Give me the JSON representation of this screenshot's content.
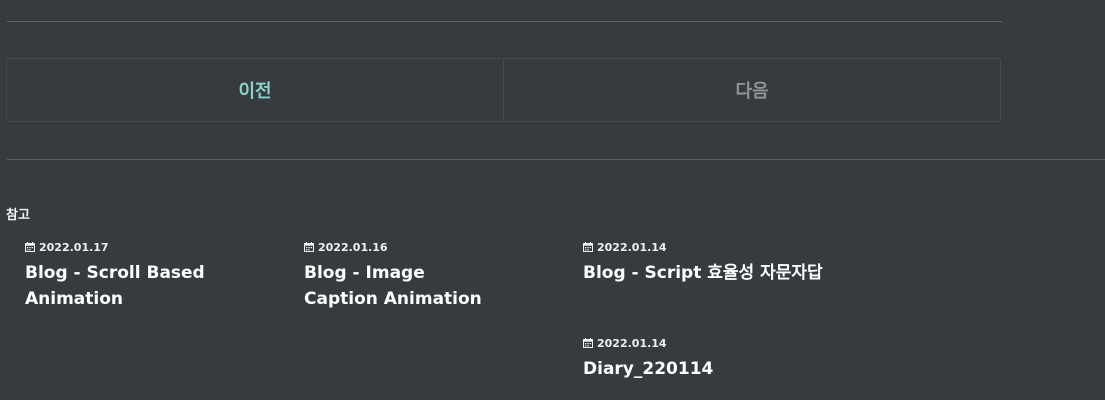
{
  "pager": {
    "prev_label": "이전",
    "next_label": "다음"
  },
  "related": {
    "title": "참고",
    "posts": [
      {
        "date": "2022.01.17",
        "title": "Blog - Scroll Based Animation"
      },
      {
        "date": "2022.01.16",
        "title": "Blog - Image Caption Animation"
      },
      {
        "date": "2022.01.14",
        "title": "Blog - Script 효율성 자문자답"
      },
      {
        "date": "2022.01.14",
        "title": "Diary_220114"
      }
    ]
  },
  "colors": {
    "background": "#363b3e",
    "prev_accent": "#8ad0cc",
    "next_muted": "#8f9497"
  },
  "icons": {
    "date": "calendar-icon"
  }
}
